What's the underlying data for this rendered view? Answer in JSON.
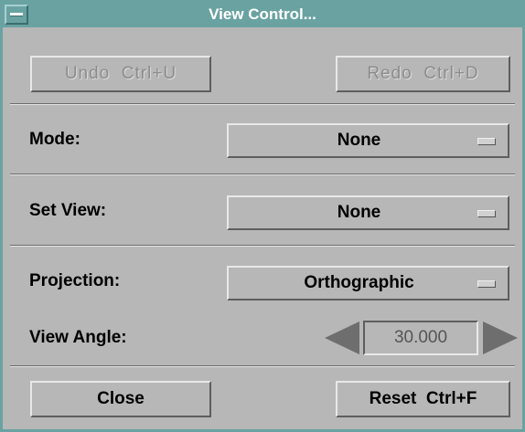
{
  "window": {
    "title": "View Control..."
  },
  "toolbar": {
    "undo_label": "Undo  Ctrl+U",
    "redo_label": "Redo  Ctrl+D"
  },
  "mode": {
    "label": "Mode:",
    "value": "None"
  },
  "set_view": {
    "label": "Set View:",
    "value": "None"
  },
  "projection": {
    "label": "Projection:",
    "value": "Orthographic"
  },
  "view_angle": {
    "label": "View Angle:",
    "value": "30.000"
  },
  "footer": {
    "close_label": "Close",
    "reset_label": "Reset  Ctrl+F"
  },
  "colors": {
    "titlebar": "#6aa2a2",
    "panel": "#b7b7b7"
  },
  "icons": {
    "window_menu": "window-menu-icon",
    "decrement": "arrow-left-icon",
    "increment": "arrow-right-icon"
  }
}
